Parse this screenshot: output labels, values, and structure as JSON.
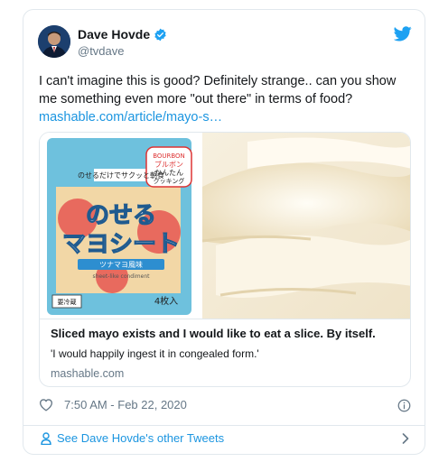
{
  "user": {
    "name": "Dave Hovde",
    "handle": "@tvdave"
  },
  "tweet": {
    "text": "I can't imagine this is good?  Definitely strange.. can you show me something even more \"out there\" in terms of food?",
    "link": "mashable.com/article/mayo-s…"
  },
  "link_card": {
    "title": "Sliced mayo exists and I would like to eat a slice. By itself.",
    "description": "'I would happily ingest it in congealed form.'",
    "domain": "mashable.com",
    "product_text": {
      "brand": "BOURBON",
      "badge_line1": "ブルボン",
      "badge_line2": "かんたん",
      "badge_line3": "クッキング",
      "tagline": "のせるだけでサクッと朝食",
      "product_line1": "のせる",
      "product_line2": "マヨシート",
      "flavor": "ツナマヨ風味",
      "subtitle": "sheet-like condiment",
      "count": "4枚入",
      "storage": "要冷蔵"
    }
  },
  "meta": {
    "timestamp": "7:50 AM - Feb 22, 2020"
  },
  "footer": {
    "more_tweets": "See Dave Hovde's other Tweets"
  },
  "icons": {
    "verified": "verified-badge-icon",
    "twitter": "twitter-bird-icon",
    "like": "heart-icon",
    "info": "info-icon",
    "profile": "person-icon",
    "chevron": "chevron-right-icon"
  },
  "colors": {
    "accent": "#1b95e0",
    "verified": "#1da1f2",
    "muted": "#657786",
    "border": "#e1e8ed"
  }
}
